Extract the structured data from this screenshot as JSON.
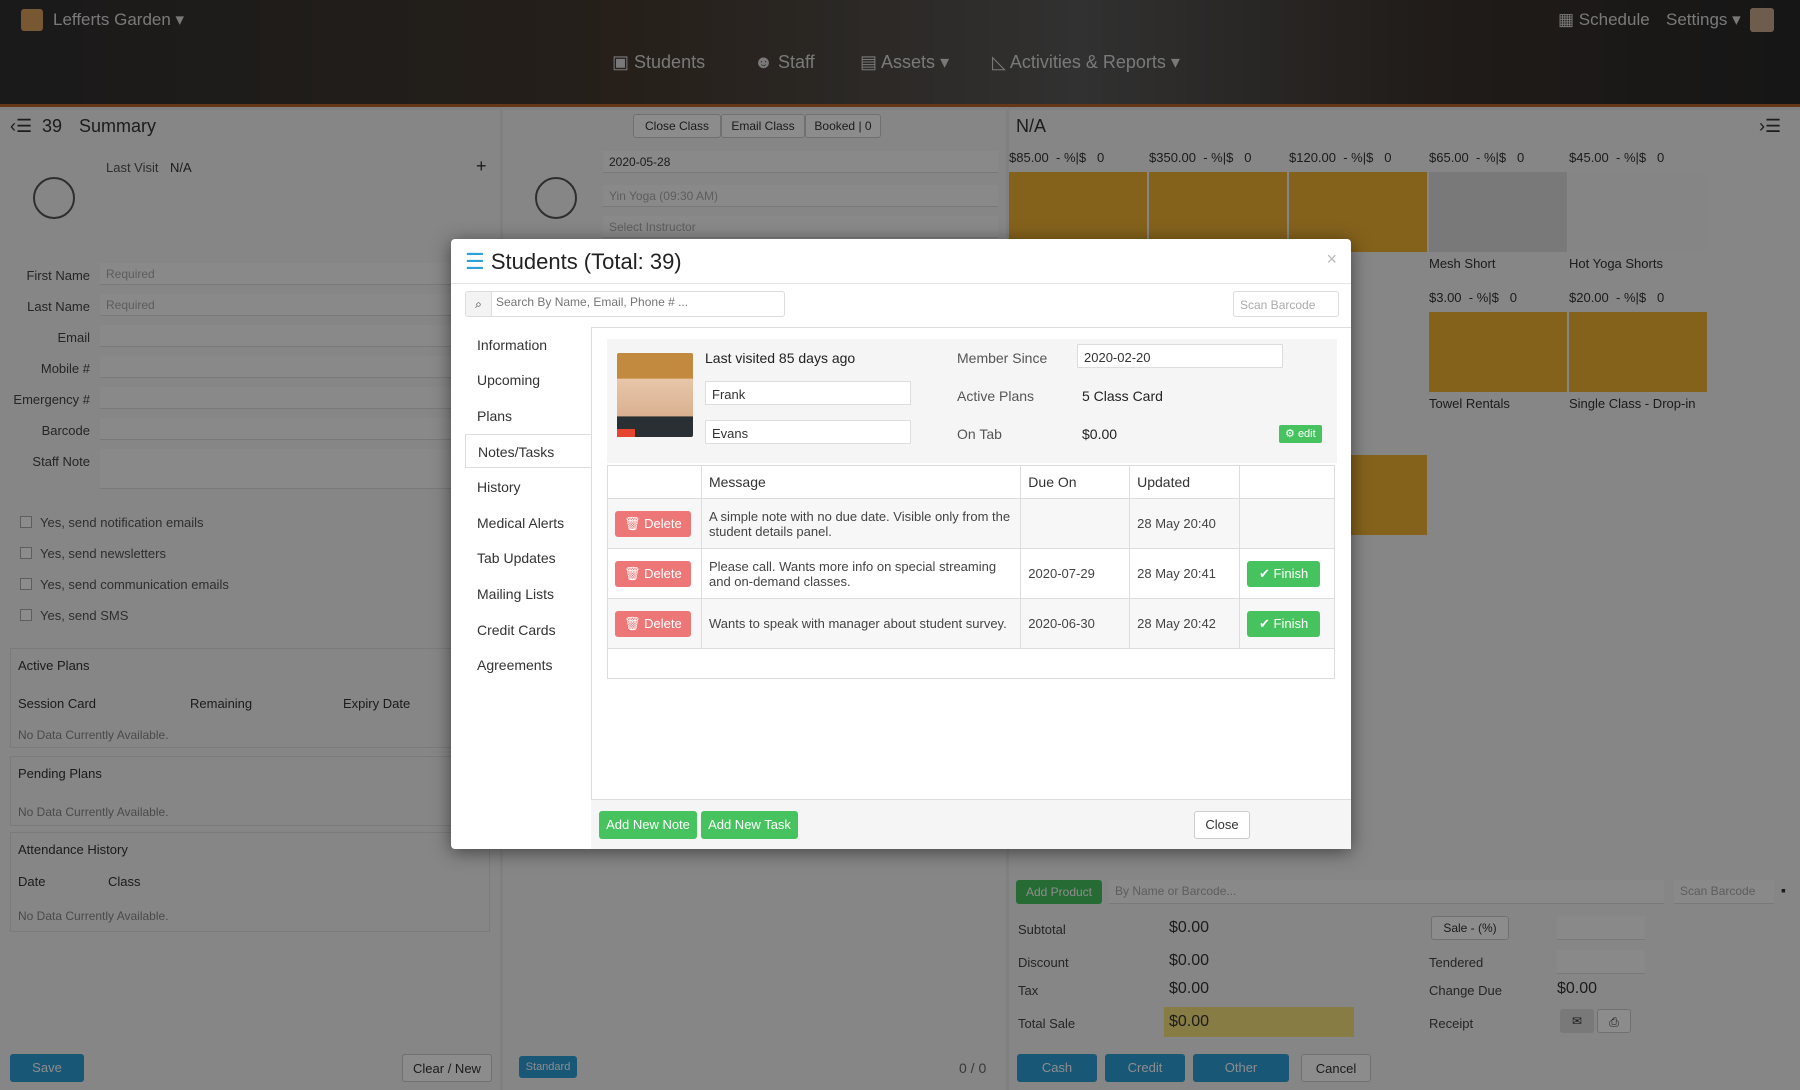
{
  "header": {
    "location": "Lefferts Garden",
    "schedule": "Schedule",
    "settings": "Settings",
    "nav": [
      {
        "label": "Students",
        "icon": "students-icon"
      },
      {
        "label": "Staff",
        "icon": "staff-icon"
      },
      {
        "label": "Assets",
        "icon": "assets-icon"
      },
      {
        "label": "Activities & Reports",
        "icon": "chart-icon"
      }
    ]
  },
  "left_panel": {
    "count": "39",
    "title": "Summary",
    "last_visit_label": "Last Visit",
    "last_visit_value": "N/A",
    "fields": [
      {
        "label": "First Name",
        "placeholder": "Required"
      },
      {
        "label": "Last Name",
        "placeholder": "Required"
      },
      {
        "label": "Email",
        "placeholder": ""
      },
      {
        "label": "Mobile #",
        "placeholder": ""
      },
      {
        "label": "Emergency #",
        "placeholder": ""
      },
      {
        "label": "Barcode",
        "placeholder": ""
      },
      {
        "label": "Staff Note",
        "placeholder": ""
      }
    ],
    "checkboxes": [
      "Yes, send notification emails",
      "Yes, send newsletters",
      "Yes, send communication emails",
      "Yes, send SMS"
    ],
    "active_plans": "Active Plans",
    "plan_cols": [
      "Session Card",
      "Remaining",
      "Expiry Date"
    ],
    "no_data": "No Data Currently Available.",
    "pending_plans": "Pending Plans",
    "attendance": "Attendance History",
    "att_cols": [
      "Date",
      "Class"
    ],
    "save": "Save",
    "clear": "Clear / New"
  },
  "middle_panel": {
    "close_class": "Close Class",
    "email_class": "Email Class",
    "booked": "Booked | 0",
    "date": "2020-05-28",
    "class": "Yin Yoga (09:30 AM)",
    "instructor": "Select Instructor",
    "standard": "Standard",
    "count": "0 / 0"
  },
  "right_panel": {
    "title": "N/A",
    "products_row1": [
      {
        "price": "$85.00",
        "disc": "- %|$",
        "qty": "0",
        "name": ""
      },
      {
        "price": "$350.00",
        "disc": "- %|$",
        "qty": "0",
        "name": ""
      },
      {
        "price": "$120.00",
        "disc": "- %|$",
        "qty": "0",
        "name": ""
      },
      {
        "price": "$65.00",
        "disc": "- %|$",
        "qty": "0",
        "name": "Mesh Short"
      },
      {
        "price": "$45.00",
        "disc": "- %|$",
        "qty": "0",
        "name": "Hot Yoga Shorts"
      }
    ],
    "products_row2": [
      {
        "price": "$3.00",
        "disc": "- %|$",
        "qty": "0",
        "name": "Towel Rentals"
      },
      {
        "price": "$20.00",
        "disc": "- %|$",
        "qty": "0",
        "name": "Single Class - Drop-in"
      }
    ],
    "add_product": "Add Product",
    "product_search": "By Name or Barcode...",
    "scan_barcode": "Scan Barcode",
    "subtotal_label": "Subtotal",
    "subtotal": "$0.00",
    "discount_label": "Discount",
    "discount": "$0.00",
    "tax_label": "Tax",
    "tax": "$0.00",
    "total_label": "Total Sale",
    "total": "$0.00",
    "sale_pct": "Sale - (%)",
    "tendered": "Tendered",
    "change_due_label": "Change Due",
    "change_due": "$0.00",
    "receipt": "Receipt",
    "cash": "Cash",
    "credit": "Credit",
    "other": "Other",
    "cancel": "Cancel"
  },
  "modal": {
    "title": "Students (Total: 39)",
    "search_placeholder": "Search By Name, Email, Phone # ...",
    "scan_placeholder": "Scan Barcode",
    "tabs": [
      "Information",
      "Upcoming",
      "Plans",
      "Notes/Tasks",
      "History",
      "Medical Alerts",
      "Tab Updates",
      "Mailing Lists",
      "Credit Cards",
      "Agreements"
    ],
    "active_tab": "Notes/Tasks",
    "profile": {
      "last_visited": "Last visited 85 days ago",
      "first_name": "Frank",
      "last_name": "Evans",
      "member_since_label": "Member Since",
      "member_since": "2020-02-20",
      "active_plans_label": "Active Plans",
      "active_plans": "5 Class Card",
      "on_tab_label": "On Tab",
      "on_tab": "$0.00",
      "edit": "edit"
    },
    "table": {
      "headers": [
        "",
        "Message",
        "Due On",
        "Updated",
        ""
      ],
      "rows": [
        {
          "message": "A simple note with no due date. Visible only from the student details panel.",
          "due": "",
          "updated": "28 May 20:40",
          "finish": ""
        },
        {
          "message": "Please call. Wants more info on special streaming and on-demand classes.",
          "due": "2020-07-29",
          "updated": "28 May 20:41",
          "finish": "Finish"
        },
        {
          "message": "Wants to speak with manager about student survey.",
          "due": "2020-06-30",
          "updated": "28 May 20:42",
          "finish": "Finish"
        }
      ],
      "delete_label": "Delete"
    },
    "add_note": "Add New Note",
    "add_task": "Add New Task",
    "close": "Close"
  }
}
